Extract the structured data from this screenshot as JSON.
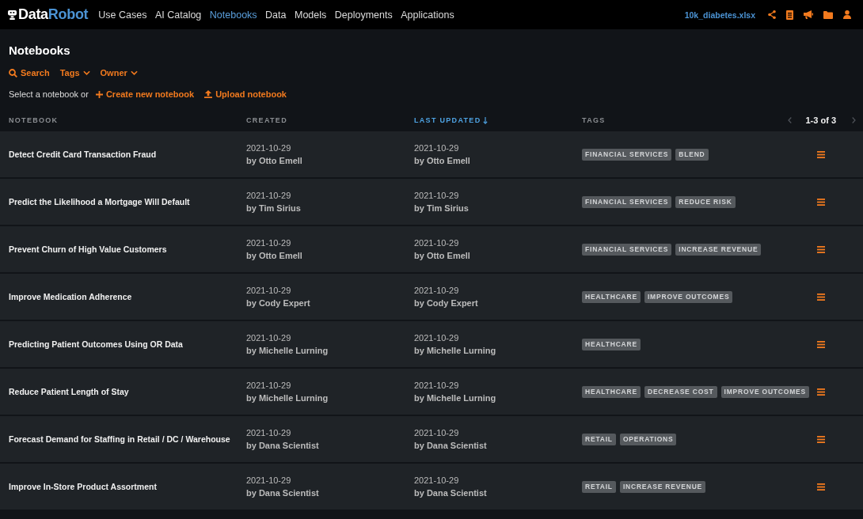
{
  "navbar": {
    "logo": [
      "Data",
      "Robot"
    ],
    "items": [
      {
        "label": "Use Cases",
        "selected": false
      },
      {
        "label": "AI Catalog",
        "selected": false
      },
      {
        "label": "Notebooks",
        "selected": true
      },
      {
        "label": "Data",
        "selected": false
      },
      {
        "label": "Models",
        "selected": false
      },
      {
        "label": "Deployments",
        "selected": false
      },
      {
        "label": "Applications",
        "selected": false
      }
    ],
    "dataset": "10k_diabetes.xlsx"
  },
  "page": {
    "title": "Notebooks",
    "filters": [
      {
        "kind": "search",
        "label": "Search"
      },
      {
        "kind": "dropdown",
        "label": "Tags"
      },
      {
        "kind": "dropdown",
        "label": "Owner"
      }
    ],
    "prompt": "Select a notebook or",
    "actions": [
      {
        "kind": "create",
        "label": "Create new notebook"
      },
      {
        "kind": "upload",
        "label": "Upload notebook"
      }
    ]
  },
  "table": {
    "columns": [
      {
        "label": "NOTEBOOK",
        "sorted": false
      },
      {
        "label": "CREATED",
        "sorted": false
      },
      {
        "label": "LAST UPDATED",
        "sorted": true
      },
      {
        "label": "TAGS",
        "sorted": false
      }
    ],
    "pagination": {
      "range": "1-3 of 3",
      "previous_disabled": true,
      "next_disabled": true
    },
    "rows": [
      {
        "name": "Detect Credit Card Transaction Fraud",
        "created": {
          "date": "2021-10-29",
          "by": "by Otto Emell"
        },
        "updated": {
          "date": "2021-10-29",
          "by": "by Otto Emell"
        },
        "tags": [
          "FINANCIAL SERVICES",
          "BLEND"
        ]
      },
      {
        "name": "Predict the Likelihood a Mortgage Will Default",
        "created": {
          "date": "2021-10-29",
          "by": "by Tim Sirius"
        },
        "updated": {
          "date": "2021-10-29",
          "by": "by Tim Sirius"
        },
        "tags": [
          "FINANCIAL SERVICES",
          "REDUCE RISK"
        ]
      },
      {
        "name": "Prevent Churn of High Value Customers",
        "created": {
          "date": "2021-10-29",
          "by": "by Otto Emell"
        },
        "updated": {
          "date": "2021-10-29",
          "by": "by Otto Emell"
        },
        "tags": [
          "FINANCIAL SERVICES",
          "INCREASE REVENUE"
        ]
      },
      {
        "name": "Improve Medication Adherence",
        "created": {
          "date": "2021-10-29",
          "by": "by Cody Expert"
        },
        "updated": {
          "date": "2021-10-29",
          "by": "by Cody Expert"
        },
        "tags": [
          "HEALTHCARE",
          "IMPROVE OUTCOMES"
        ]
      },
      {
        "name": "Predicting Patient Outcomes Using OR Data",
        "created": {
          "date": "2021-10-29",
          "by": "by Michelle Lurning"
        },
        "updated": {
          "date": "2021-10-29",
          "by": "by Michelle Lurning"
        },
        "tags": [
          "HEALTHCARE"
        ]
      },
      {
        "name": "Reduce Patient Length of Stay",
        "created": {
          "date": "2021-10-29",
          "by": "by Michelle Lurning"
        },
        "updated": {
          "date": "2021-10-29",
          "by": "by Michelle Lurning"
        },
        "tags": [
          "HEALTHCARE",
          "DECREASE COST",
          "IMPROVE OUTCOMES"
        ]
      },
      {
        "name": "Forecast Demand for Staffing in Retail / DC / Warehouse",
        "created": {
          "date": "2021-10-29",
          "by": "by Dana Scientist"
        },
        "updated": {
          "date": "2021-10-29",
          "by": "by Dana Scientist"
        },
        "tags": [
          "RETAIL",
          "OPERATIONS"
        ]
      },
      {
        "name": "Improve In-Store Product Assortment",
        "created": {
          "date": "2021-10-29",
          "by": "by Dana Scientist"
        },
        "updated": {
          "date": "2021-10-29",
          "by": "by Dana Scientist"
        },
        "tags": [
          "RETAIL",
          "INCREASE REVENUE"
        ]
      }
    ]
  }
}
